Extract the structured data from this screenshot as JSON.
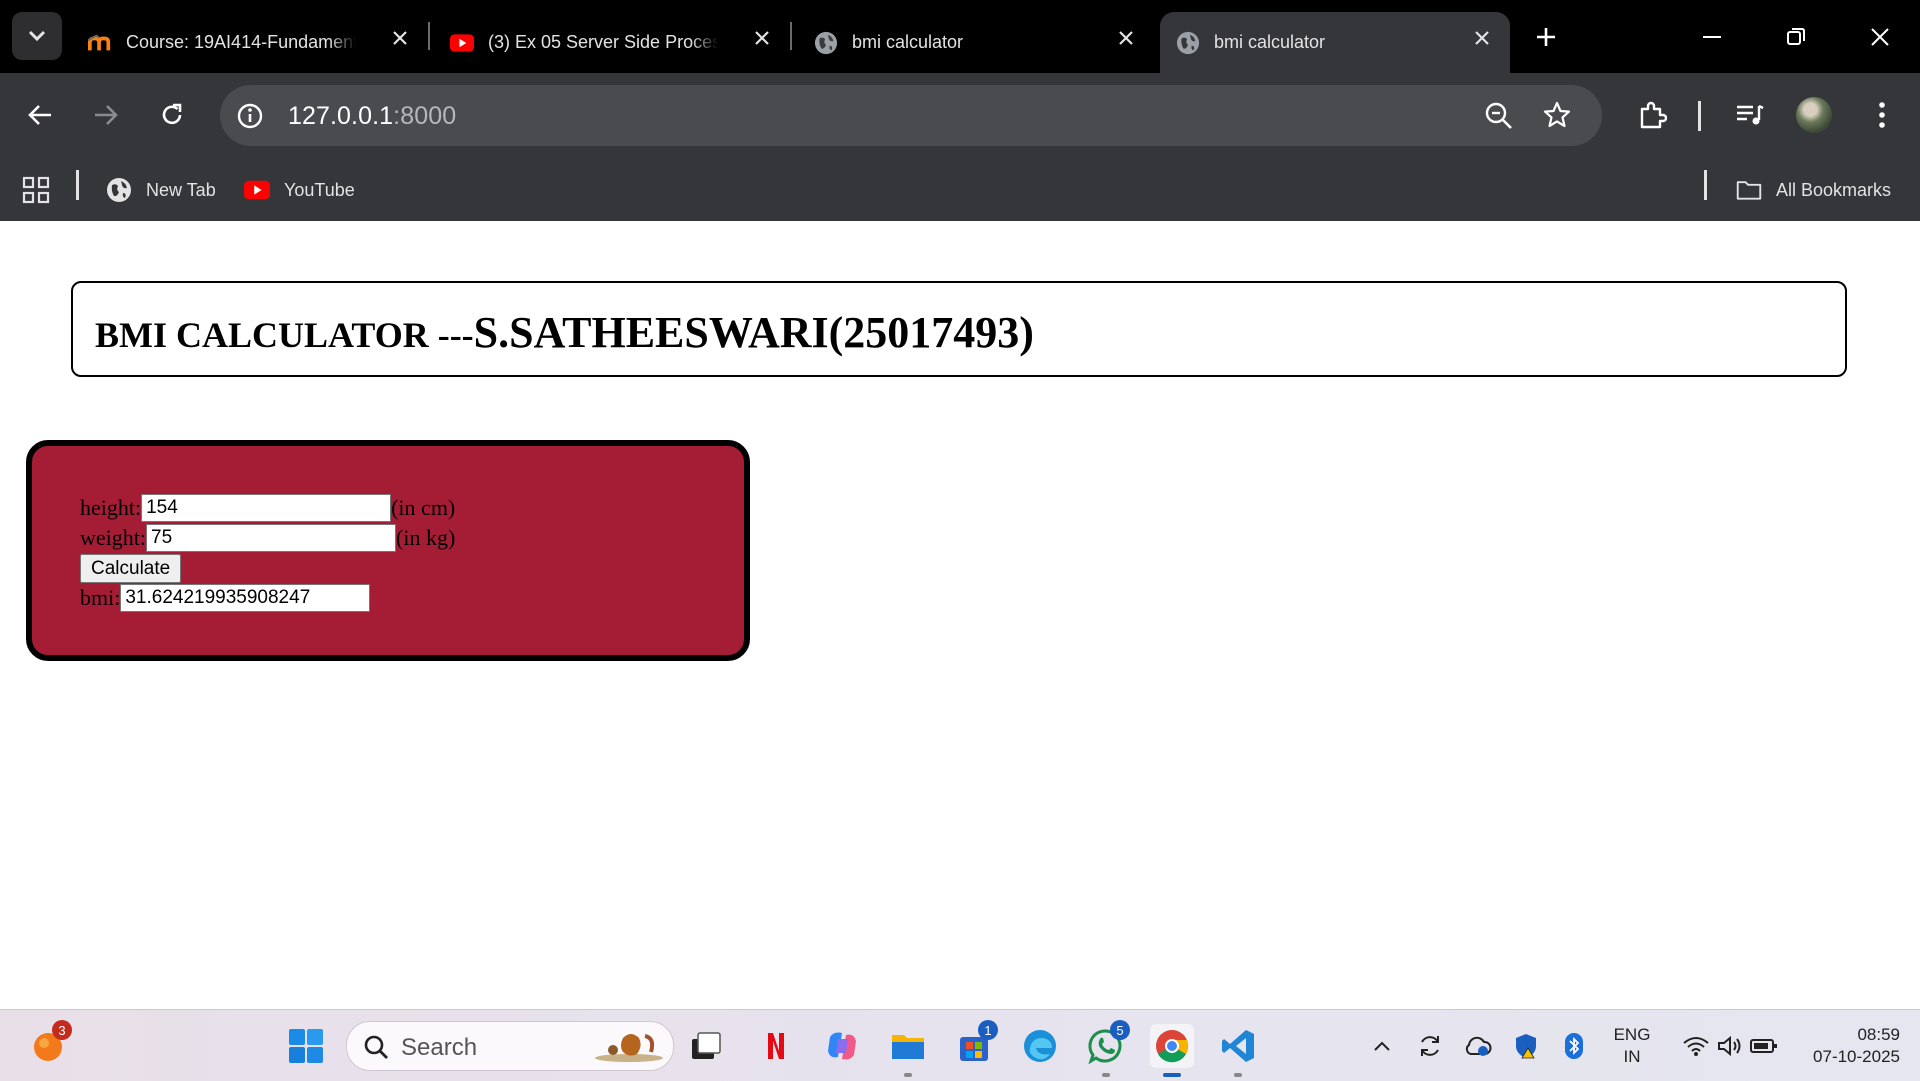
{
  "browser": {
    "tabs": [
      {
        "title": "Course: 19AI414-Fundamentals",
        "favicon": "moodle-icon",
        "active": false
      },
      {
        "title": "(3) Ex 05 Server Side Processing",
        "favicon": "youtube-icon",
        "active": false
      },
      {
        "title": "bmi calculator",
        "favicon": "globe-icon",
        "active": false
      },
      {
        "title": "bmi calculator",
        "favicon": "globe-icon",
        "active": true
      }
    ],
    "url_host": "127.0.0.1",
    "url_port": ":8000",
    "bookmarks": [
      {
        "label": "New Tab",
        "icon": "globe-icon"
      },
      {
        "label": "YouTube",
        "icon": "youtube-icon"
      }
    ],
    "all_bookmarks_label": "All Bookmarks"
  },
  "page": {
    "header_prefix": "BMI CALCULATOR ---",
    "header_name": "S.SATHEESWARI(25017493)",
    "form": {
      "height_label": "height:",
      "height_value": "154",
      "height_unit": "(in cm)",
      "weight_label": "weight:",
      "weight_value": "75",
      "weight_unit": "(in kg)",
      "calculate_label": "Calculate",
      "bmi_label": "bmi:",
      "bmi_value": "31.624219935908247"
    },
    "colors": {
      "form_bg": "#a51d35",
      "border": "#000000"
    }
  },
  "taskbar": {
    "search_label": "Search",
    "notification_badge": "3",
    "store_badge": "1",
    "whatsapp_badge": "5",
    "language_line1": "ENG",
    "language_line2": "IN",
    "time": "08:59",
    "date": "07-10-2025"
  }
}
